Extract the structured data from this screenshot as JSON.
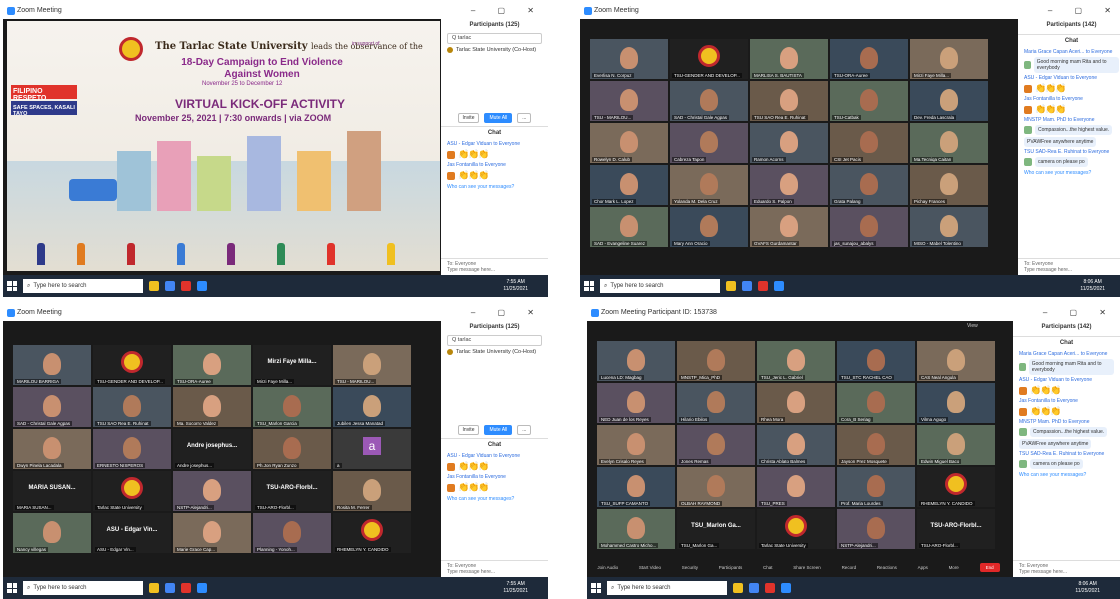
{
  "windows": [
    {
      "title": "Zoom Meeting",
      "banner": {
        "univ_name": "The Tarlac State University",
        "univ_rest": "leads the observance of the",
        "campaign": "18-Day Campaign to End Violence Against Women",
        "dates": "November 25 to December 12",
        "kickoff": "VIRTUAL KICK-OFF ACTIVITY",
        "when": "November 25, 2021 | 7:30 onwards | via ZOOM",
        "support": "in support of",
        "filipino": "FILIPINO RESPETO",
        "safe": "SAFE SPACES, KASALI TAYO"
      },
      "panel": {
        "participants_header": "Participants (125)",
        "search": "Q tarlac",
        "participant": "Tarlac State University (Co-Host)",
        "invite": "Invite",
        "mute_all": "Mute All",
        "more": "...",
        "chat_header": "Chat",
        "messages": [
          {
            "from": "ASU - Edgar Viduan to Everyone"
          },
          {
            "from": "Jas Fontanilla to Everyone"
          }
        ],
        "who_can_see": "Who can see your messages?",
        "to": "To: Everyone",
        "compose": "Type message here..."
      },
      "taskbar": {
        "search": "Type here to search",
        "time": "7:55 AM",
        "date": "11/25/2021"
      }
    },
    {
      "title": "Zoom Meeting",
      "tiles": [
        "Everlisa N. Corpuz",
        "TSU-GENDER AND DEVELOP...",
        "MARLISA S. BAUTISTA",
        "TSU-ORA-Auree",
        "Mirzi Faye Milla...",
        "TSU - MARILOU...",
        "SAD - Christal Gale Agpas",
        "TSU SAO Rea E. Ruhinat",
        "TSU-Catbak",
        "Dev. Freda Lascrala",
        "Rowelyn D. Calub",
        "Cabreza Tapon",
        "Ramon Acorns",
        "CSI Jet Pacis",
        "Ma.Tecniqa Caitan",
        "Chor Mark L. Lopez",
        "Yolanda M. Dela Cruz",
        "Eduardo S. Palpon",
        "Grata Palang",
        "Pichay Frances",
        "SAD - Evangeline Suarez",
        "Mary Ann Oracio",
        "GVAFS Gurdamantar",
        "jas_sunajou_abalys",
        "MISO - Mabel Tolentino"
      ],
      "panel": {
        "participants_header": "Participants (142)",
        "chat_header": "Chat",
        "messages": [
          {
            "from": "Maria Grace Capan Aceri... to Everyone",
            "text": "Good morning mam Rita and to everybody"
          },
          {
            "from": "ASU - Edgar Viduan to Everyone"
          },
          {
            "from": "Jas Fontanilla to Everyone"
          },
          {
            "from": "MNSTP Mam. PhD to Everyone",
            "text": "Compassion...the highest value."
          },
          {
            "from": "",
            "text": "PVAWFree anywhere anytime"
          },
          {
            "from": "TSU SAD-Rea E. Ruhinat to Everyone",
            "text": "camera on please po"
          }
        ],
        "who_can_see": "Who can see your messages?",
        "to": "To: Everyone",
        "compose": "Type message here..."
      },
      "taskbar": {
        "search": "Type here to search",
        "time": "8:06 AM",
        "date": "11/25/2021"
      }
    },
    {
      "title": "Zoom Meeting",
      "tiles": [
        "MARILOU BARRIGA",
        "TSU-GENDER AND DEVELOP...",
        "TSU-ORA-Auree",
        "Mirzi Faye Milla...",
        "TSU - MARILOU...",
        "SAD - Christal Gale Agpas",
        "TSU SAO Rea E. Ruhinat",
        "Ma. Socorro Valdez",
        "TSU_Marlon Garcia",
        "Jubilen Jessa Manatad",
        "Dwyn Pinela Lacadala",
        "ERNESTO NISPEROS",
        "Andre josephus...",
        "Ph.Jon Ryan Zunzo",
        "a",
        "MARIA SUSAN...",
        "Tarlac State University",
        "NSTP-Alejandri...",
        "TSU-ARO-Florbl...",
        "Rosita M. Ferrer",
        "Nancy villegas",
        "ASU - Edgar Vin...",
        "Marie Grace Cap...",
        "Planning - Yonoh...",
        "RHEMELYN Y. CANDIDO"
      ],
      "panel": {
        "participants_header": "Participants (125)",
        "search": "Q tarlac",
        "participant": "Tarlac State University (Co-Host)",
        "invite": "Invite",
        "mute_all": "Mute All",
        "more": "...",
        "chat_header": "Chat",
        "messages": [
          {
            "from": "ASU - Edgar Viduan to Everyone"
          },
          {
            "from": "Jas Fontanilla to Everyone"
          }
        ],
        "who_can_see": "Who can see your messages?",
        "to": "To: Everyone",
        "compose": "Type message here..."
      },
      "taskbar": {
        "search": "Type here to search",
        "time": "7:55 AM",
        "date": "11/25/2021"
      }
    },
    {
      "title": "Zoom Meeting Participant ID: 153738",
      "view": "View",
      "tiles": [
        "Lucena LD: Magbag",
        "MNSTP_Mica_PhD",
        "TSU_Jeric L. Gabriel",
        "TSU_STC RACHEL CAO",
        "CAS Neal Angula",
        "NED Juan de los Reyes",
        "Hilario Ebilos",
        "Rhea Mora",
        "Cora_B Seriag",
        "Vilma Agugo",
        "Evelyn Crisalo Reyes",
        "Jones Remas",
        "Christa Ablato Balmes",
        "Jayson Prez Mosquete",
        "Edwin Miguel Baco",
        "TSU_SUFP CAMANTO",
        "OLBAH RAYMOND",
        "TSU_PRES",
        "Prof. Maria Lourdes",
        "RHEMELYN Y. CANDIDO",
        "Mohammed Castro Micho...",
        "TSU_Marlon Ga...",
        "Tarlac State University",
        "NSTP-Alejandri...",
        "TSU-ARO-Florbl..."
      ],
      "controls": [
        "Join Audio",
        "Start Video",
        "Security",
        "Participants",
        "Chat",
        "Share Screen",
        "Record",
        "Reactions",
        "Apps",
        "More",
        "End"
      ],
      "participants_count": "142",
      "panel": {
        "participants_header": "Participants (142)",
        "chat_header": "Chat",
        "messages": [
          {
            "from": "Maria Grace Capan Aceri... to Everyone",
            "text": "Good morning mam Rita and to everybody"
          },
          {
            "from": "ASU - Edgar Viduan to Everyone"
          },
          {
            "from": "Jas Fontanilla to Everyone"
          },
          {
            "from": "MNSTP Mam. PhD to Everyone",
            "text": "Compassion...the highest value."
          },
          {
            "from": "",
            "text": "PVAWFree anywhere anytime"
          },
          {
            "from": "TSU SAD-Rea E. Ruhinat to Everyone",
            "text": "camera on please po"
          }
        ],
        "who_can_see": "Who can see your messages?",
        "to": "To: Everyone",
        "compose": "Type message here..."
      },
      "taskbar": {
        "search": "Type here to search",
        "time": "8:06 AM",
        "date": "11/25/2021"
      }
    }
  ],
  "emoji": "👏👏👏",
  "colors": {
    "zoom_blue": "#2d8cff",
    "taskbar": "#1e2a3a",
    "tsu_red": "#c0282d",
    "tsu_gold": "#f0c020"
  }
}
